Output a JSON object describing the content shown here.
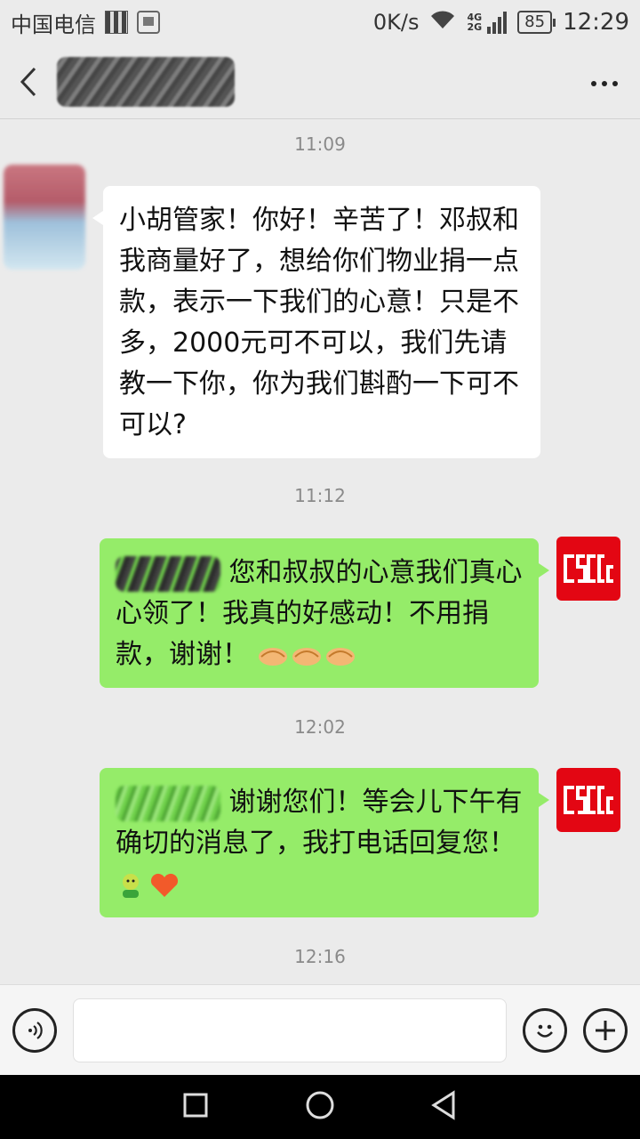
{
  "status_bar": {
    "carrier": "中国电信",
    "net_speed": "0K/s",
    "network_top": "4G",
    "network_bottom": "2G",
    "battery": "85",
    "time": "12:29"
  },
  "header": {
    "back_icon": "chevron-left-icon",
    "more_icon": "more-dots-icon"
  },
  "messages": [
    {
      "type": "time",
      "text": "11:09"
    },
    {
      "type": "received",
      "text": "小胡管家！你好！辛苦了！邓叔和我商量好了，想给你们物业捐一点款，表示一下我们的心意！只是不多，2000元可不可以，我们先请教一下你，你为我们斟酌一下可不可以?"
    },
    {
      "type": "time",
      "text": "11:12"
    },
    {
      "type": "sent",
      "text": "您和叔叔的心意我们真心心领了！我真的好感动！不用捐款，谢谢！",
      "emoji": [
        "handshake-icon",
        "handshake-icon",
        "handshake-icon"
      ]
    },
    {
      "type": "time",
      "text": "12:02"
    },
    {
      "type": "sent",
      "text": "谢谢您们！等会儿下午有确切的消息了，我打电话回复您！",
      "emoji": [
        "smiling-face-icon",
        "heart-icon"
      ]
    },
    {
      "type": "time",
      "text": "12:16"
    }
  ],
  "input_bar": {
    "voice_icon": "voice-icon",
    "emoji_icon": "emoji-icon",
    "plus_icon": "plus-icon",
    "input_value": ""
  },
  "colors": {
    "sent_bubble": "#95ec69",
    "received_bubble": "#ffffff",
    "background": "#ebebeb",
    "avatar_brand": "#e30613"
  }
}
